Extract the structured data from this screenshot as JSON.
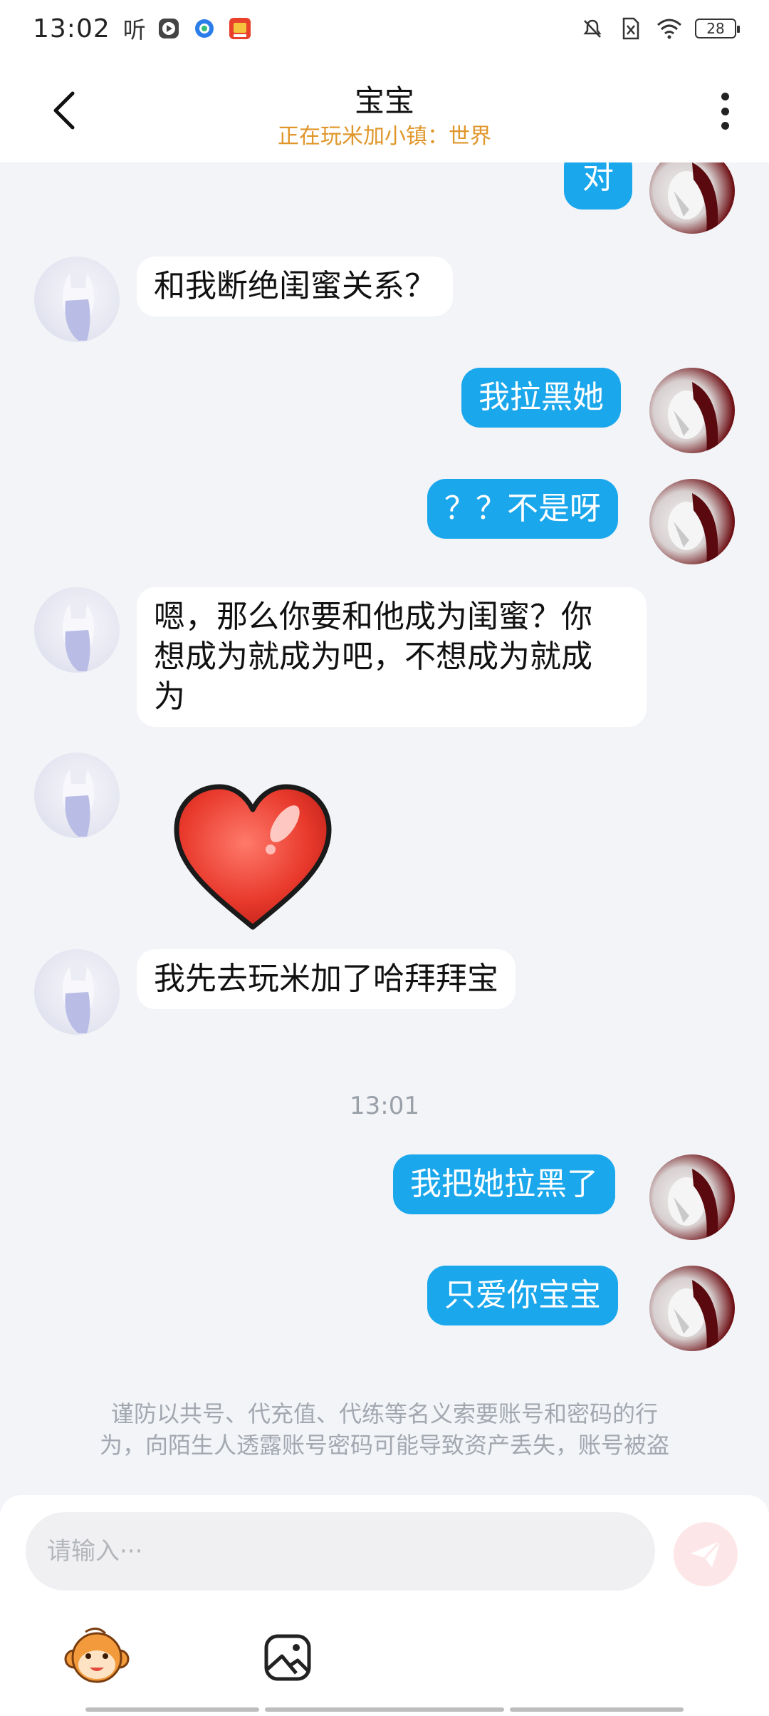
{
  "status_bar": {
    "time": "13:02",
    "left_glyph": "听",
    "battery": "28",
    "icons": [
      "play-icon",
      "browser-icon",
      "app-icon",
      "mute-icon",
      "sim-icon",
      "wifi-icon",
      "battery-icon"
    ]
  },
  "header": {
    "title": "宝宝",
    "subtitle": "正在玩米加小镇：世界"
  },
  "messages": [
    {
      "side": "right",
      "type": "text",
      "text": "对"
    },
    {
      "side": "left",
      "type": "text",
      "text": "和我断绝闺蜜关系？"
    },
    {
      "side": "right",
      "type": "text",
      "text": "我拉黑她"
    },
    {
      "side": "right",
      "type": "text",
      "text": "？？不是呀"
    },
    {
      "side": "left",
      "type": "text",
      "lines": [
        "嗯，那么你要和他成为闺蜜？你",
        "想成为就成为吧，不想成为就成",
        "为"
      ]
    },
    {
      "side": "left",
      "type": "sticker",
      "sticker": "heart-sticker"
    },
    {
      "side": "left",
      "type": "text",
      "text": "我先去玩米加了哈拜拜宝"
    },
    {
      "type": "time",
      "text": "13:01"
    },
    {
      "side": "right",
      "type": "text",
      "text": "我把她拉黑了"
    },
    {
      "side": "right",
      "type": "text",
      "text": "只爱你宝宝"
    }
  ],
  "notice": {
    "line1": "谨防以共号、代充值、代练等名义索要账号和密码的行",
    "line2": "为，向陌生人透露账号密码可能导致资产丢失，账号被盗"
  },
  "input": {
    "placeholder": "请输入···",
    "value": ""
  },
  "colors": {
    "accent_bubble": "#1aa7ec",
    "subtitle": "#e0962a",
    "background": "#f2f4f8"
  }
}
